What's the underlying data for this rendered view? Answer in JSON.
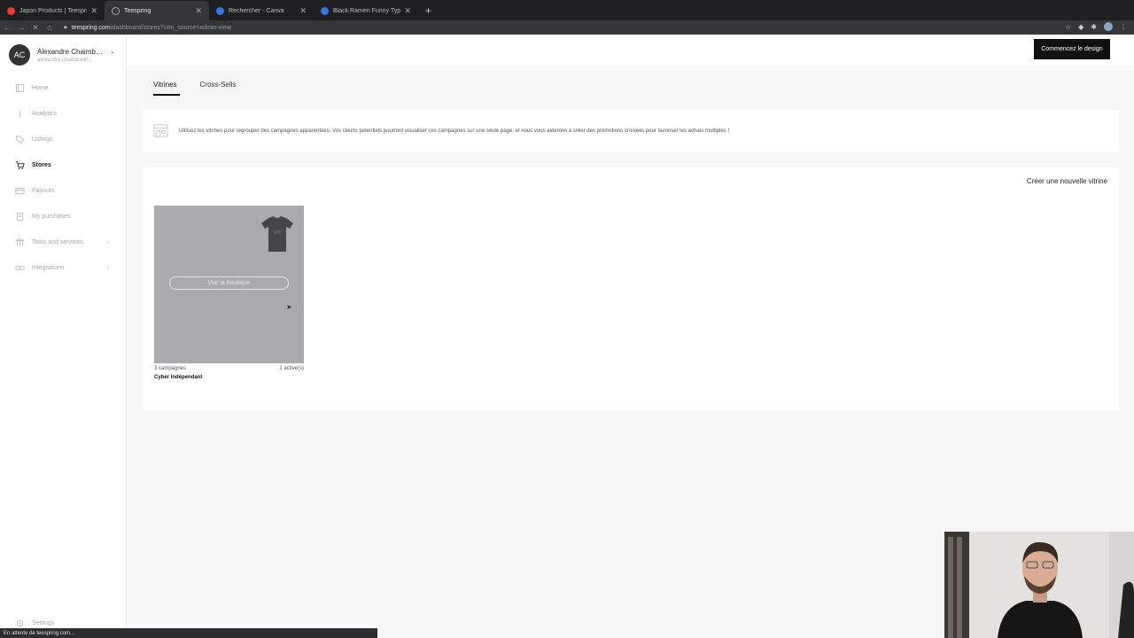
{
  "browser": {
    "tabs": [
      {
        "title": "Japon Products | Teespring",
        "color": "#e03b3b"
      },
      {
        "title": "Teespring",
        "color": "#9a9a9a"
      },
      {
        "title": "Rechercher - Canva",
        "color": "#3b74e0"
      },
      {
        "title": "Black Ramen Funny Typograp…",
        "color": "#3b74e0"
      }
    ],
    "url_host": "teespring.com",
    "url_path": "/dashboard/stores?utm_source=admin-view",
    "status": "En attente de teespring.com..."
  },
  "account": {
    "initials": "AC",
    "name": "Alexandre Chaimb…",
    "email": "alexandre.chaimbault…"
  },
  "sidebar": {
    "items": [
      {
        "label": "Home",
        "icon": "home-icon"
      },
      {
        "label": "Analytics",
        "icon": "analytics-icon"
      },
      {
        "label": "Listings",
        "icon": "tag-icon"
      },
      {
        "label": "Stores",
        "icon": "cart-icon"
      },
      {
        "label": "Payouts",
        "icon": "card-icon"
      },
      {
        "label": "My purchases",
        "icon": "receipt-icon"
      },
      {
        "label": "Tools and services",
        "icon": "tools-icon"
      },
      {
        "label": "Integrations",
        "icon": "link-icon"
      }
    ],
    "settings_label": "Settings"
  },
  "topbar": {
    "cta_label": "Commencez le design"
  },
  "tabs": [
    {
      "label": "Vitrines"
    },
    {
      "label": "Cross-Sells"
    }
  ],
  "banner": {
    "text": "Utilisez les vitrines pour regrouper des campagnes apparentées. Vos clients potentiels pourront visualiser ces campagnes sur une seule page, et nous vous aiderons à créer des promotions croisées pour favoriser les achats multiples !"
  },
  "stores": {
    "create_label": "Créer une nouvelle vitrine",
    "cards": [
      {
        "view_label": "Voir la boutique",
        "campaigns": "3 campagnes",
        "active": "1 active(s)",
        "name": "Cyber Indépendant"
      }
    ]
  },
  "colors": {
    "accent": "#111111",
    "card_bg": "#a9aaab",
    "page_bg": "#f7f7f8"
  }
}
